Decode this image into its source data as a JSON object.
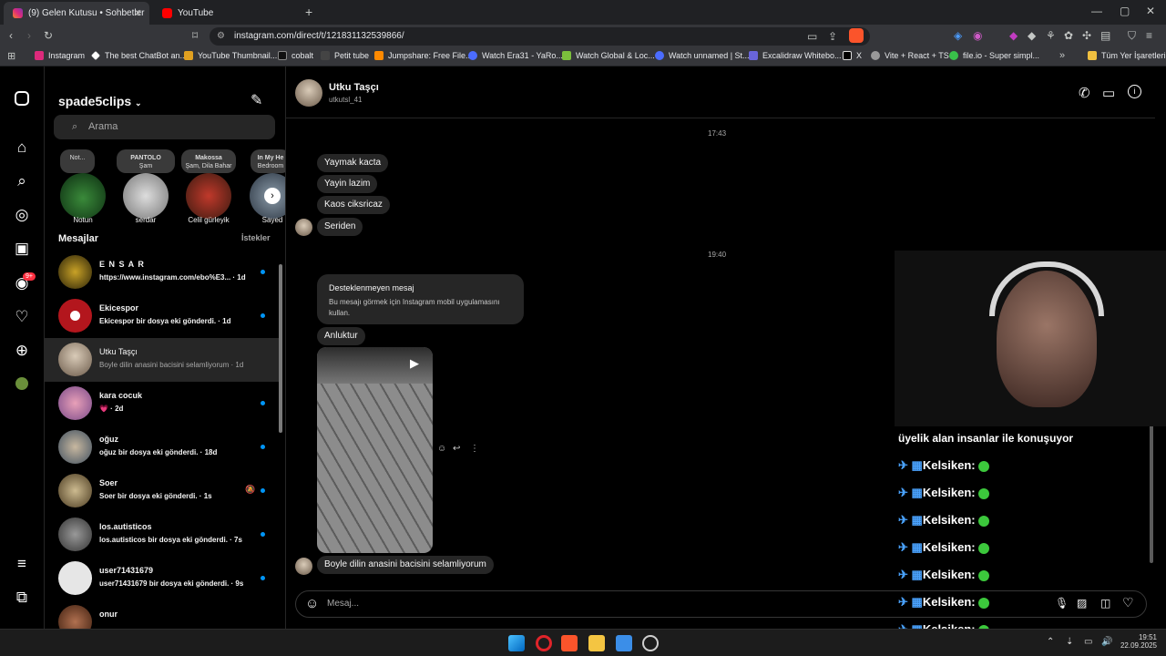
{
  "browser": {
    "tabs": [
      {
        "title": "(9) Gelen Kutusu • Sohbetler",
        "active": true
      },
      {
        "title": "YouTube",
        "active": false
      }
    ],
    "url": "instagram.com/direct/t/121831132539866/",
    "bookmarks": [
      "Instagram",
      "The best ChatBot an...",
      "YouTube Thumbnail...",
      "cobalt",
      "Petit tube",
      "Jumpshare: Free File...",
      "Watch Era31 - YaRo...",
      "Watch Global & Loc...",
      "Watch unnamed | St...",
      "Excalidraw Whitebo...",
      "X",
      "Vite + React + TS",
      "file.io - Super simpl..."
    ],
    "all_bookmarks": "Tüm Yer İşaretleri"
  },
  "nav": {
    "notif_badge": "9+"
  },
  "inbox": {
    "username": "spade5clips",
    "search_placeholder": "Arama",
    "notes": [
      "Not...",
      "PANTOLO",
      "Makossa",
      "In My He"
    ],
    "note_subs": [
      "",
      "Şam",
      "Şam, Dila Bahar",
      "Bedroom"
    ],
    "stories": [
      "Notun",
      "serdar",
      "Celil gürleyik",
      "Sayed"
    ],
    "messages_title": "Mesajlar",
    "requests": "İstekler",
    "conversations": [
      {
        "name": "E N S A R",
        "preview": "https://www.instagram.com/ebo%E3... · 1d",
        "unread": true
      },
      {
        "name": "Ekicespor",
        "preview": "Ekicespor bir dosya eki gönderdi. · 1d",
        "unread": true
      },
      {
        "name": "Utku Taşçı",
        "preview": "Boyle dilin anasini bacisini selamliyorum · 1d",
        "unread": false
      },
      {
        "name": "kara cocuk",
        "preview": "💗 · 2d",
        "unread": true
      },
      {
        "name": "oğuz",
        "preview": "oğuz bir dosya eki gönderdi. · 18d",
        "unread": true
      },
      {
        "name": "Soer",
        "preview": "Soer bir dosya eki gönderdi. · 1s",
        "unread": true
      },
      {
        "name": "los.autisticos",
        "preview": "los.autisticos bir dosya eki gönderdi. · 7s",
        "unread": true
      },
      {
        "name": "user71431679",
        "preview": "user71431679 bir dosya eki gönderdi. · 9s",
        "unread": true
      },
      {
        "name": "onur",
        "preview": "",
        "unread": true
      }
    ]
  },
  "chat": {
    "name": "Utku Taşçı",
    "handle": "utkutsl_41",
    "time1": "17:43",
    "msgs1": [
      "Yaymak kacta",
      "Yayin lazim",
      "Kaos ciksricaz",
      "Seriden"
    ],
    "time2": "19:40",
    "unsupported_title": "Desteklenmeyen mesaj",
    "unsupported_body": "Bu mesajı görmek için Instagram mobil uygulamasını kullan.",
    "msg_anluktur": "Anluktur",
    "last_msg": "Boyle dilin anasini bacisini selamliyorum",
    "composer_placeholder": "Mesaj..."
  },
  "overlay": {
    "caption": "üyelik alan insanlar ile konuşuyor",
    "label": "Kelsiken:",
    "count": 7
  },
  "taskbar": {
    "time": "19:51",
    "date": "22.09.2025"
  }
}
